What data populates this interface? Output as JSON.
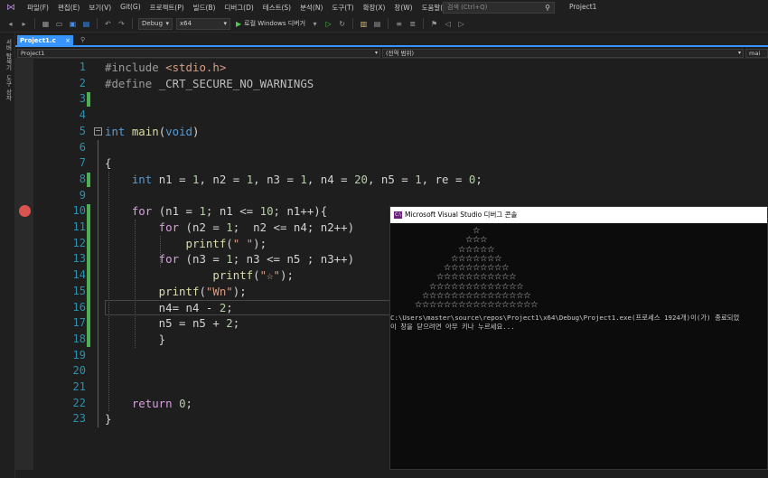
{
  "menu": {
    "items": [
      "파일(F)",
      "편집(E)",
      "보기(V)",
      "Git(G)",
      "프로젝트(P)",
      "빌드(B)",
      "디버그(D)",
      "테스트(S)",
      "분석(N)",
      "도구(T)",
      "확장(X)",
      "창(W)",
      "도움말(H)"
    ],
    "search_placeholder": "검색 (Ctrl+Q)",
    "project_title": "Project1"
  },
  "toolbar": {
    "config": "Debug",
    "platform": "x64",
    "run_label": "로컬 Windows 디버거"
  },
  "side_strip": {
    "labels": [
      "서버 탐색기",
      "도구 상자"
    ]
  },
  "tabs": [
    {
      "label": "Project1.c",
      "close": "×"
    }
  ],
  "navbar": {
    "project": "Project1",
    "scope": "(전역 범위)",
    "member": "mai"
  },
  "editor": {
    "line_numbers": [
      "1",
      "2",
      "3",
      "4",
      "5",
      "6",
      "7",
      "8",
      "9",
      "10",
      "11",
      "12",
      "13",
      "14",
      "15",
      "16",
      "17",
      "18",
      "19",
      "20",
      "21",
      "22",
      "23"
    ],
    "breakpoint_lines": [
      10
    ],
    "lines": [
      {
        "n": 1,
        "tokens": [
          {
            "t": "#include ",
            "c": "k-inc"
          },
          {
            "t": "<stdio.h>",
            "c": "k-str"
          }
        ]
      },
      {
        "n": 2,
        "tokens": [
          {
            "t": "#define ",
            "c": "k-inc"
          },
          {
            "t": "_CRT_SECURE_NO_WARNINGS",
            "c": "k-macro"
          }
        ]
      },
      {
        "n": 3,
        "tokens": []
      },
      {
        "n": 4,
        "tokens": []
      },
      {
        "n": 5,
        "tokens": [
          {
            "t": "int ",
            "c": "k-blue"
          },
          {
            "t": "main",
            "c": "k-fn"
          },
          {
            "t": "(",
            "c": ""
          },
          {
            "t": "void",
            "c": "k-blue"
          },
          {
            "t": ")",
            "c": ""
          }
        ]
      },
      {
        "n": 6,
        "tokens": []
      },
      {
        "n": 7,
        "tokens": [
          {
            "t": "{",
            "c": ""
          }
        ]
      },
      {
        "n": 8,
        "tokens": [
          {
            "t": "    int ",
            "c": "k-blue"
          },
          {
            "t": "n1 = ",
            "c": ""
          },
          {
            "t": "1",
            "c": "k-num"
          },
          {
            "t": ", n2 = ",
            "c": ""
          },
          {
            "t": "1",
            "c": "k-num"
          },
          {
            "t": ", n3 = ",
            "c": ""
          },
          {
            "t": "1",
            "c": "k-num"
          },
          {
            "t": ", n4 = ",
            "c": ""
          },
          {
            "t": "20",
            "c": "k-num"
          },
          {
            "t": ", n5 = ",
            "c": ""
          },
          {
            "t": "1",
            "c": "k-num"
          },
          {
            "t": ", re = ",
            "c": ""
          },
          {
            "t": "0",
            "c": "k-num"
          },
          {
            "t": ";",
            "c": ""
          }
        ]
      },
      {
        "n": 9,
        "tokens": []
      },
      {
        "n": 10,
        "tokens": [
          {
            "t": "    for ",
            "c": "k-purple"
          },
          {
            "t": "(n1 = ",
            "c": ""
          },
          {
            "t": "1",
            "c": "k-num"
          },
          {
            "t": "; n1 <= ",
            "c": ""
          },
          {
            "t": "10",
            "c": "k-num"
          },
          {
            "t": "; n1++){",
            "c": ""
          }
        ]
      },
      {
        "n": 11,
        "tokens": [
          {
            "t": "        for ",
            "c": "k-purple"
          },
          {
            "t": "(n2 = ",
            "c": ""
          },
          {
            "t": "1",
            "c": "k-num"
          },
          {
            "t": ";  n2 <= n4; n2++)",
            "c": ""
          }
        ]
      },
      {
        "n": 12,
        "tokens": [
          {
            "t": "            printf",
            "c": "k-fn"
          },
          {
            "t": "(",
            "c": ""
          },
          {
            "t": "\" \"",
            "c": "k-str"
          },
          {
            "t": ");",
            "c": ""
          }
        ]
      },
      {
        "n": 13,
        "tokens": [
          {
            "t": "        for ",
            "c": "k-purple"
          },
          {
            "t": "(n3 = ",
            "c": ""
          },
          {
            "t": "1",
            "c": "k-num"
          },
          {
            "t": "; n3 <= n5 ; n3++)",
            "c": ""
          }
        ]
      },
      {
        "n": 14,
        "tokens": [
          {
            "t": "                printf",
            "c": "k-fn"
          },
          {
            "t": "(",
            "c": ""
          },
          {
            "t": "\"☆\"",
            "c": "k-str"
          },
          {
            "t": ");",
            "c": ""
          }
        ]
      },
      {
        "n": 15,
        "tokens": [
          {
            "t": "        printf",
            "c": "k-fn"
          },
          {
            "t": "(",
            "c": ""
          },
          {
            "t": "\"Wn\"",
            "c": "k-str"
          },
          {
            "t": ");",
            "c": ""
          }
        ]
      },
      {
        "n": 16,
        "tokens": [
          {
            "t": "        n4= n4 - ",
            "c": ""
          },
          {
            "t": "2",
            "c": "k-num"
          },
          {
            "t": ";",
            "c": ""
          }
        ]
      },
      {
        "n": 17,
        "tokens": [
          {
            "t": "        n5 = n5 + ",
            "c": ""
          },
          {
            "t": "2",
            "c": "k-num"
          },
          {
            "t": ";",
            "c": ""
          }
        ]
      },
      {
        "n": 18,
        "tokens": [
          {
            "t": "        }",
            "c": ""
          }
        ]
      },
      {
        "n": 19,
        "tokens": []
      },
      {
        "n": 20,
        "tokens": []
      },
      {
        "n": 21,
        "tokens": []
      },
      {
        "n": 22,
        "tokens": [
          {
            "t": "    return ",
            "c": "k-purple"
          },
          {
            "t": "0",
            "c": "k-num"
          },
          {
            "t": ";",
            "c": ""
          }
        ]
      },
      {
        "n": 23,
        "tokens": [
          {
            "t": "}",
            "c": ""
          }
        ]
      }
    ]
  },
  "console": {
    "title": "Microsoft Visual Studio 디버그 콘솔",
    "icon_label": "C:\\",
    "pyramid_rows": [
      "☆",
      "☆☆☆",
      "☆☆☆☆☆",
      "☆☆☆☆☆☆☆",
      "☆☆☆☆☆☆☆☆☆",
      "☆☆☆☆☆☆☆☆☆☆☆",
      "☆☆☆☆☆☆☆☆☆☆☆☆☆",
      "☆☆☆☆☆☆☆☆☆☆☆☆☆☆☆",
      "☆☆☆☆☆☆☆☆☆☆☆☆☆☆☆☆☆"
    ],
    "path_line": "C:\\Users\\master\\source\\repos\\Project1\\x64\\Debug\\Project1.exe(프로세스 1924개)이(가) 종료되었",
    "prompt_line": "이 창을 닫으려면 아무 키나 누르세요..."
  }
}
